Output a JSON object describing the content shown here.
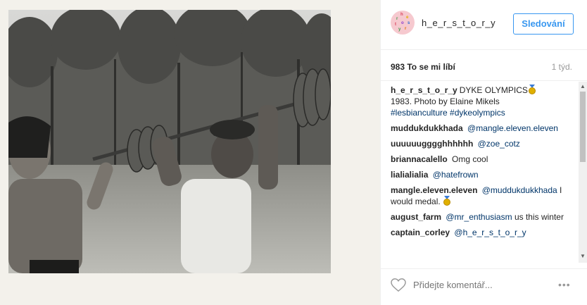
{
  "post": {
    "username": "h_e_r_s_t_o_r_y",
    "follow_label": "Sledování",
    "likes": "983 To se mi líbí",
    "time": "1 týd.",
    "add_comment_placeholder": "Přidejte komentář...",
    "more_icon": "more-icon",
    "avatar_letters": [
      "h",
      "e",
      "r",
      "s",
      "t",
      "o",
      "r",
      "y"
    ]
  },
  "caption": {
    "user": "h_e_r_s_t_o_r_y",
    "text_a": "DYKE OLYMPICS",
    "text_b": "1983. Photo by Elaine Mikels",
    "tags": "#lesbianculture #dykeolympics"
  },
  "comments": [
    {
      "user": "muddukdukkhada",
      "link": "@mangle.eleven.eleven",
      "text": ""
    },
    {
      "user": "uuuuuugggghhhhhh",
      "link": "@zoe_cotz",
      "text": ""
    },
    {
      "user": "briannacalello",
      "link": "",
      "text": "Omg cool"
    },
    {
      "user": "lialialialia",
      "link": "@hatefrown",
      "text": ""
    },
    {
      "user": "mangle.eleven.eleven",
      "link": "@muddukdukkhada",
      "text": "I would medal."
    },
    {
      "user": "august_farm",
      "link": "@mr_enthusiasm",
      "text": "us this winter"
    },
    {
      "user": "captain_corley",
      "link": "@h_e_r_s_t_o_r_y",
      "text": ""
    }
  ],
  "colors": {
    "accent": "#3897f0",
    "link": "#003569",
    "muted": "#999999"
  }
}
